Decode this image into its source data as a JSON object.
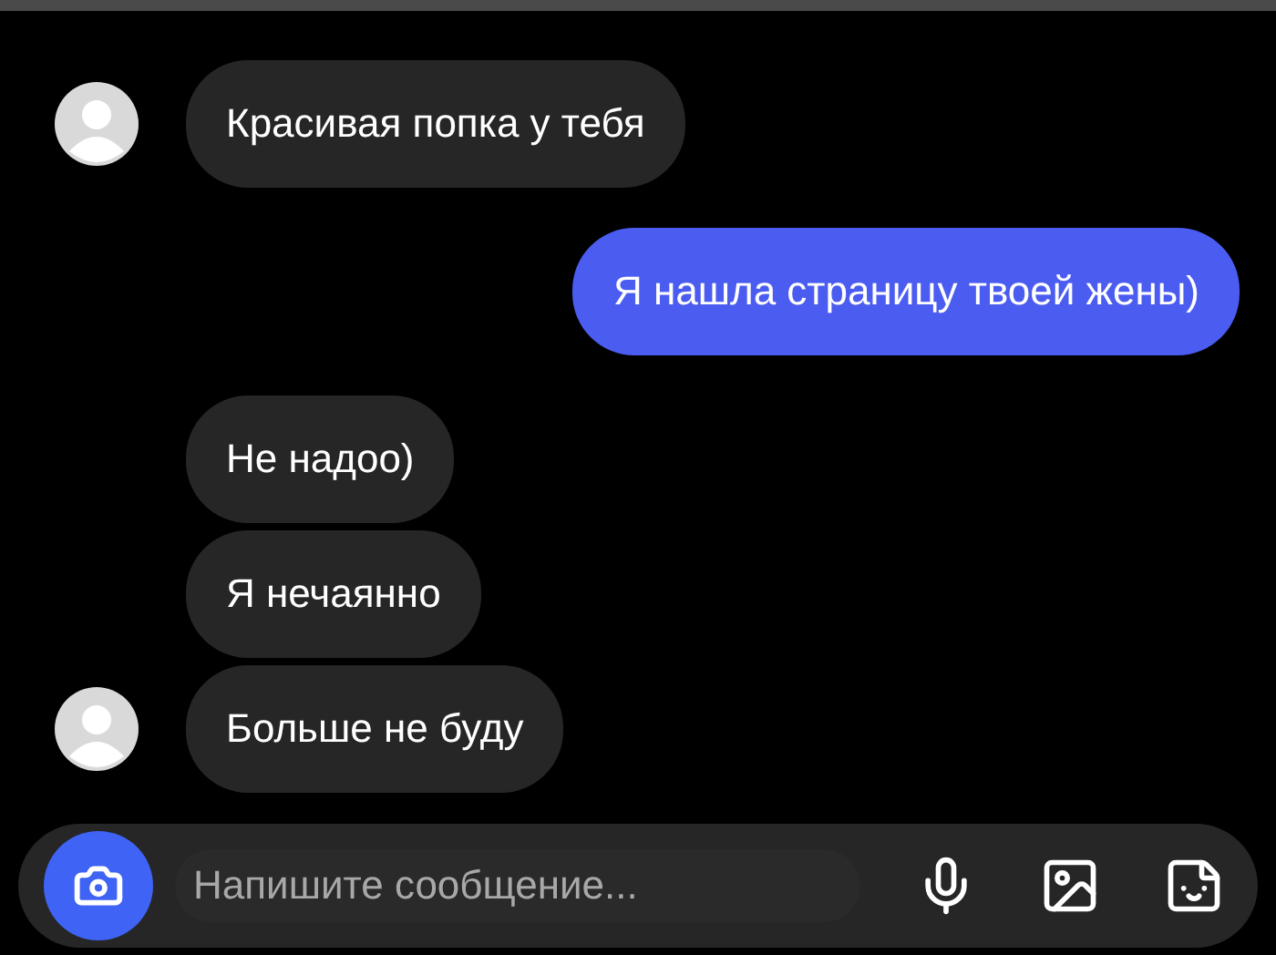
{
  "messages": [
    {
      "kind": "incoming",
      "text": "Красивая попка у тебя",
      "avatar": true
    },
    {
      "kind": "outgoing",
      "text": "Я нашла страницу твоей жены)",
      "avatar": false
    },
    {
      "kind": "incoming",
      "text": "Не надоо)",
      "avatar": false
    },
    {
      "kind": "incoming",
      "text": "Я нечаянно",
      "avatar": false
    },
    {
      "kind": "incoming",
      "text": "Больше не буду",
      "avatar": true
    }
  ],
  "composer": {
    "placeholder": "Напишите сообщение..."
  }
}
